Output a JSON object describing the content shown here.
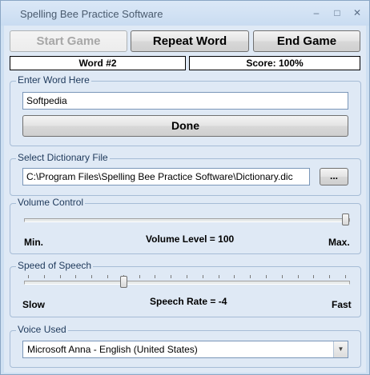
{
  "window": {
    "title": "Spelling Bee Practice Software",
    "controls": {
      "minimize": "–",
      "maximize": "□",
      "close": "✕"
    }
  },
  "toolbar": {
    "start_label": "Start Game",
    "repeat_label": "Repeat Word",
    "end_label": "End Game"
  },
  "status": {
    "word": "Word #2",
    "score": "Score: 100%"
  },
  "enter_word": {
    "legend": "Enter Word Here",
    "value": "Softpedia",
    "done_label": "Done"
  },
  "dictionary": {
    "legend": "Select Dictionary File",
    "path": "C:\\Program Files\\Spelling Bee Practice Software\\Dictionary.dic",
    "browse_label": "..."
  },
  "volume": {
    "legend": "Volume Control",
    "min_label": "Min.",
    "max_label": "Max.",
    "level_text": "Volume Level = 100",
    "level": 100,
    "range": [
      0,
      100
    ]
  },
  "speed": {
    "legend": "Speed of Speech",
    "slow_label": "Slow",
    "fast_label": "Fast",
    "rate_text": "Speech Rate = -4",
    "rate": -4,
    "range": [
      -10,
      10
    ]
  },
  "voice": {
    "legend": "Voice Used",
    "selected": "Microsoft Anna - English (United States)"
  }
}
